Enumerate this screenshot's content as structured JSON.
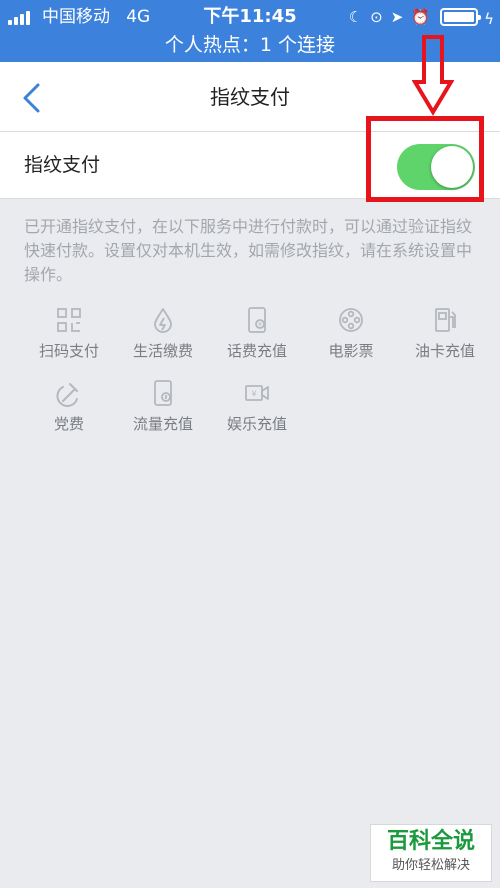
{
  "status_bar": {
    "carrier": "中国移动",
    "network": "4G",
    "time": "下午11:45",
    "hotspot": "个人热点：1 个连接"
  },
  "nav": {
    "back_icon": "chevron-left-icon",
    "title": "指纹支付"
  },
  "setting": {
    "label": "指纹支付",
    "toggle_on": true,
    "toggle_color": "#5ed46a"
  },
  "description": "已开通指纹支付，在以下服务中进行付款时，可以通过验证指纹快速付款。设置仅对本机生效，如需修改指纹，请在系统设置中操作。",
  "services": [
    {
      "label": "扫码支付",
      "icon": "qr-scan-icon"
    },
    {
      "label": "生活缴费",
      "icon": "water-drop-icon"
    },
    {
      "label": "话费充值",
      "icon": "phone-yen-icon"
    },
    {
      "label": "电影票",
      "icon": "film-reel-icon"
    },
    {
      "label": "油卡充值",
      "icon": "fuel-pump-icon"
    },
    {
      "label": "党费",
      "icon": "hammer-sickle-icon"
    },
    {
      "label": "流量充值",
      "icon": "phone-data-icon"
    },
    {
      "label": "娱乐充值",
      "icon": "video-yen-icon"
    }
  ],
  "annotation_color": "#e8141c",
  "watermark": {
    "title": "百科全说",
    "subtitle": "助你轻松解决"
  }
}
